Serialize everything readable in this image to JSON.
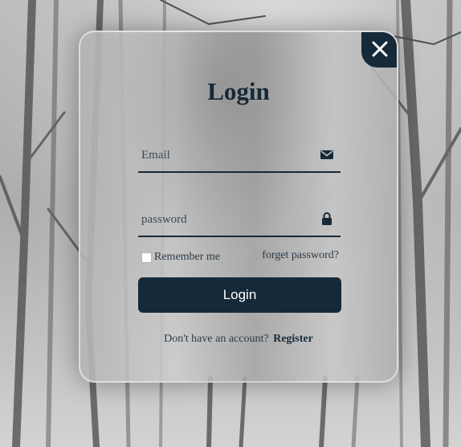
{
  "form": {
    "title": "Login",
    "email_placeholder": "Email",
    "password_placeholder": "password",
    "remember_label": "Remember me",
    "remember_checked": false,
    "forgot_label": "forget password?",
    "submit_label": "Login",
    "register_prompt": "Don't have an account?",
    "register_link": "Register"
  },
  "icons": {
    "close": "close-icon",
    "email": "mail-icon",
    "password": "lock-icon"
  },
  "colors": {
    "accent": "#162938",
    "text": "#2c3a46",
    "button_text": "#ffffff"
  }
}
